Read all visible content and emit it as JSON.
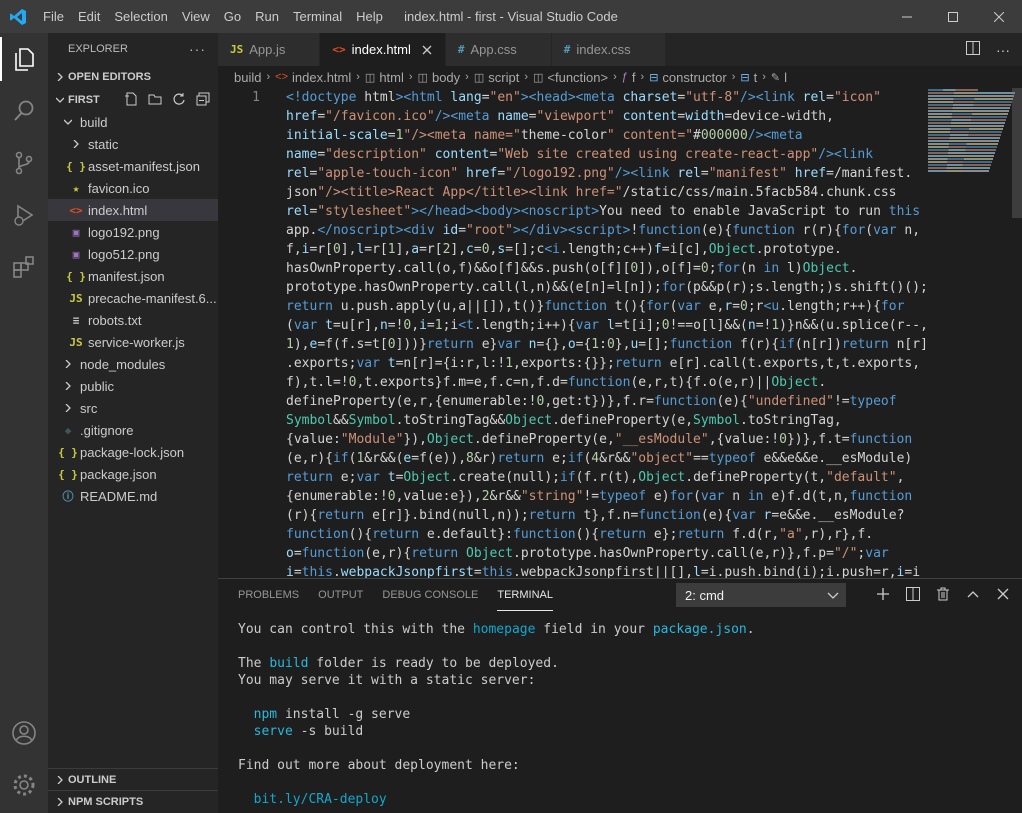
{
  "window": {
    "title": "index.html - first - Visual Studio Code",
    "menu": [
      "File",
      "Edit",
      "Selection",
      "View",
      "Go",
      "Run",
      "Terminal",
      "Help"
    ]
  },
  "colors": {
    "accent": "#007acc",
    "activity_bar": "#333333",
    "sidebar": "#252526",
    "editor": "#1e1e1e",
    "titlebar": "#3c3c3c"
  },
  "activity_bar": {
    "top": [
      "files-icon",
      "search-icon",
      "source-control-icon",
      "run-debug-icon",
      "extensions-icon"
    ],
    "bottom": [
      "account-icon",
      "settings-gear-icon"
    ]
  },
  "sidebar": {
    "title": "EXPLORER",
    "open_editors": "OPEN EDITORS",
    "folder": "FIRST",
    "tree": [
      {
        "label": "build",
        "type": "folder-open",
        "depth": 1
      },
      {
        "label": "static",
        "type": "folder",
        "depth": 2
      },
      {
        "label": "asset-manifest.json",
        "type": "json",
        "depth": 2
      },
      {
        "label": "favicon.ico",
        "type": "ico",
        "depth": 2
      },
      {
        "label": "index.html",
        "type": "html",
        "depth": 2,
        "selected": true
      },
      {
        "label": "logo192.png",
        "type": "png",
        "depth": 2
      },
      {
        "label": "logo512.png",
        "type": "png",
        "depth": 2
      },
      {
        "label": "manifest.json",
        "type": "json",
        "depth": 2
      },
      {
        "label": "precache-manifest.6...",
        "type": "js",
        "depth": 2
      },
      {
        "label": "robots.txt",
        "type": "txt",
        "depth": 2
      },
      {
        "label": "service-worker.js",
        "type": "js",
        "depth": 2
      },
      {
        "label": "node_modules",
        "type": "folder",
        "depth": 1
      },
      {
        "label": "public",
        "type": "folder",
        "depth": 1
      },
      {
        "label": "src",
        "type": "folder",
        "depth": 1
      },
      {
        "label": ".gitignore",
        "type": "git",
        "depth": 1
      },
      {
        "label": "package-lock.json",
        "type": "json",
        "depth": 1
      },
      {
        "label": "package.json",
        "type": "json",
        "depth": 1
      },
      {
        "label": "README.md",
        "type": "md",
        "depth": 1
      }
    ],
    "outline": "OUTLINE",
    "npm_scripts": "NPM SCRIPTS"
  },
  "tabs": [
    {
      "label": "App.js",
      "icon": "JS",
      "active": false
    },
    {
      "label": "index.html",
      "icon": "<>",
      "active": true
    },
    {
      "label": "App.css",
      "icon": "#",
      "active": false
    },
    {
      "label": "index.css",
      "icon": "#",
      "active": false
    }
  ],
  "breadcrumb": [
    "build",
    "index.html",
    "html",
    "body",
    "script",
    "<function>",
    "f",
    "constructor",
    "t",
    "l"
  ],
  "editor": {
    "line_number": "1",
    "lines": [
      "<!doctype html><html lang=\"en\"><head><meta charset=\"utf-8\"/><link rel=\"icon\"",
      "href=\"/favicon.ico\"/><meta name=\"viewport\" content=\"width=device-width,",
      "initial-scale=1\"/><meta name=\"theme-color\" content=\"#000000\"/><meta",
      "name=\"description\" content=\"Web site created using create-react-app\"/><link",
      "rel=\"apple-touch-icon\" href=\"/logo192.png\"/><link rel=\"manifest\" href=\"/manifest.",
      "json\"/><title>React App</title><link href=\"/static/css/main.5facb584.chunk.css\"",
      "rel=\"stylesheet\"></head><body><noscript>You need to enable JavaScript to run this",
      "app.</noscript><div id=\"root\"></div><script>!function(e){function r(r){for(var n,",
      "f,i=r[0],l=r[1],a=r[2],c=0,s=[];c<i.length;c++)f=i[c],Object.prototype.",
      "hasOwnProperty.call(o,f)&&o[f]&&s.push(o[f][0]),o[f]=0;for(n in l)Object.",
      "prototype.hasOwnProperty.call(l,n)&&(e[n]=l[n]);for(p&&p(r);s.length;)s.shift()();",
      "return u.push.apply(u,a||[]),t()}function t(){for(var e,r=0;r<u.length;r++){for",
      "(var t=u[r],n=!0,i=1;i<t.length;i++){var l=t[i];0!==o[l]&&(n=!1)}n&&(u.splice(r--,",
      "1),e=f(f.s=t[0]))}return e}var n={},o={1:0},u=[];function f(r){if(n[r])return n[r]",
      ".exports;var t=n[r]={i:r,l:!1,exports:{}};return e[r].call(t.exports,t,t.exports,",
      "f),t.l=!0,t.exports}f.m=e,f.c=n,f.d=function(e,r,t){f.o(e,r)||Object.",
      "defineProperty(e,r,{enumerable:!0,get:t})},f.r=function(e){\"undefined\"!=typeof",
      "Symbol&&Symbol.toStringTag&&Object.defineProperty(e,Symbol.toStringTag,",
      "{value:\"Module\"}),Object.defineProperty(e,\"__esModule\",{value:!0})},f.t=function",
      "(e,r){if(1&r&&(e=f(e)),8&r)return e;if(4&r&&\"object\"==typeof e&&e&&e.__esModule)",
      "return e;var t=Object.create(null);if(f.r(t),Object.defineProperty(t,\"default\",",
      "{enumerable:!0,value:e}),2&r&&\"string\"!=typeof e)for(var n in e)f.d(t,n,function",
      "(r){return e[r]}.bind(null,n));return t},f.n=function(e){var r=e&&e.__esModule?",
      "function(){return e.default}:function(){return e};return f.d(r,\"a\",r),r},f.",
      "o=function(e,r){return Object.prototype.hasOwnProperty.call(e,r)},f.p=\"/\";var",
      "i=this.webpackJsonpfirst=this.webpackJsonpfirst||[],l=i.push.bind(i);i.push=r,i=i"
    ]
  },
  "panel": {
    "tabs": [
      "PROBLEMS",
      "OUTPUT",
      "DEBUG CONSOLE",
      "TERMINAL"
    ],
    "active_tab": "TERMINAL",
    "terminal_select": "2: cmd",
    "terminal_lines": [
      {
        "parts": [
          [
            "You can control this with the ",
            ""
          ],
          [
            "homepage",
            "tcyan"
          ],
          [
            " field in your ",
            ""
          ],
          [
            "package.json",
            "tbcyan"
          ],
          [
            ".",
            ""
          ]
        ]
      },
      {
        "parts": [
          [
            "",
            ""
          ]
        ]
      },
      {
        "parts": [
          [
            "The ",
            ""
          ],
          [
            "build",
            "tbcyan"
          ],
          [
            " folder is ready to be deployed.",
            ""
          ]
        ]
      },
      {
        "parts": [
          [
            "You may serve it with a static server:",
            ""
          ]
        ]
      },
      {
        "parts": [
          [
            "",
            ""
          ]
        ]
      },
      {
        "parts": [
          [
            "  ",
            ""
          ],
          [
            "npm",
            "tbcyan"
          ],
          [
            " install -g serve",
            ""
          ]
        ]
      },
      {
        "parts": [
          [
            "  ",
            ""
          ],
          [
            "serve",
            "tbcyan"
          ],
          [
            " -s build",
            ""
          ]
        ]
      },
      {
        "parts": [
          [
            "",
            ""
          ]
        ]
      },
      {
        "parts": [
          [
            "Find out more about deployment here:",
            ""
          ]
        ]
      },
      {
        "parts": [
          [
            "",
            ""
          ]
        ]
      },
      {
        "parts": [
          [
            "  ",
            ""
          ],
          [
            "bit.ly/CRA-deploy",
            "tcyan"
          ]
        ]
      }
    ]
  }
}
